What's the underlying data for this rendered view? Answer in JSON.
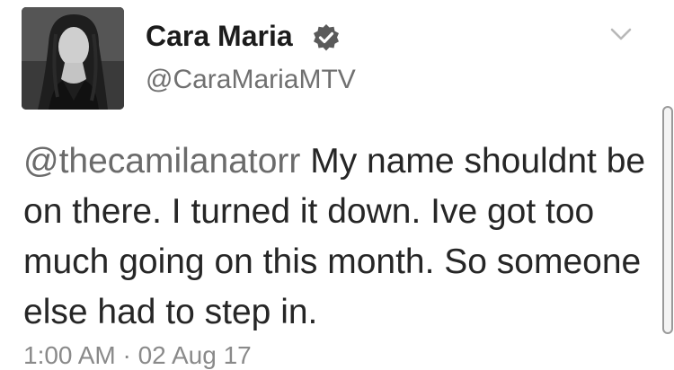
{
  "tweet": {
    "author": {
      "display_name": "Cara Maria",
      "handle": "@CaraMariaMTV",
      "verified_icon": "verified-badge-icon",
      "avatar": "profile-photo"
    },
    "menu_icon": "chevron-down-icon",
    "text": {
      "mention": "@thecamilanatorr",
      "body": " My name shouldnt be on there. I turned it down. Ive got too much going on this month. So someone else had to step in."
    },
    "timestamp": "1:00 AM · 02 Aug 17"
  }
}
